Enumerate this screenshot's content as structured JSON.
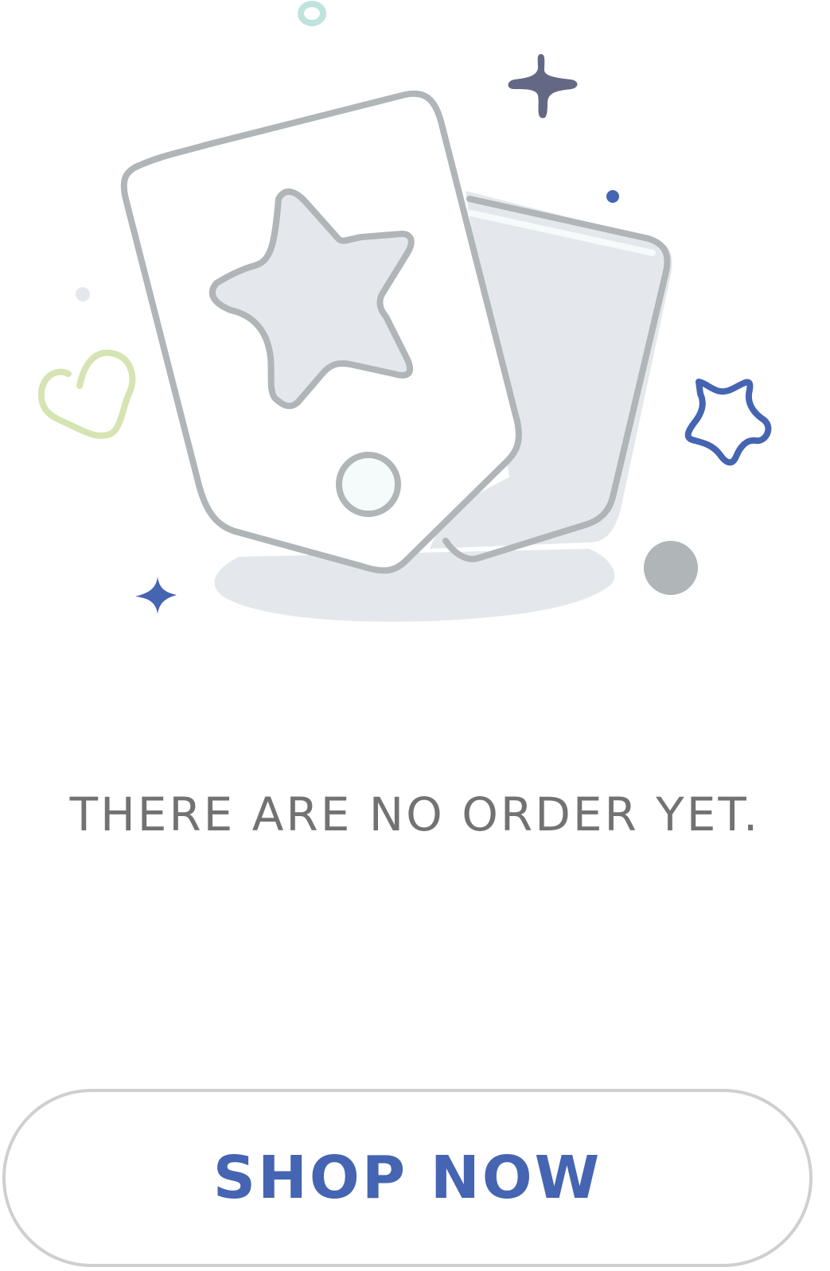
{
  "empty_state": {
    "illustration_icon": "empty-cards-illustration",
    "message": "THERE ARE NO ORDER YET."
  },
  "actions": {
    "shop_now_label": "SHOP NOW"
  },
  "colors": {
    "accent": "#4564b2",
    "message_text": "#727272",
    "button_border": "#cfcfd1",
    "card_outline": "#b0b5b8",
    "card_fill": "#e4e8ec",
    "heart": "#d6e4b3",
    "ring": "#bfe3de",
    "sparkle_dark": "#636985"
  }
}
